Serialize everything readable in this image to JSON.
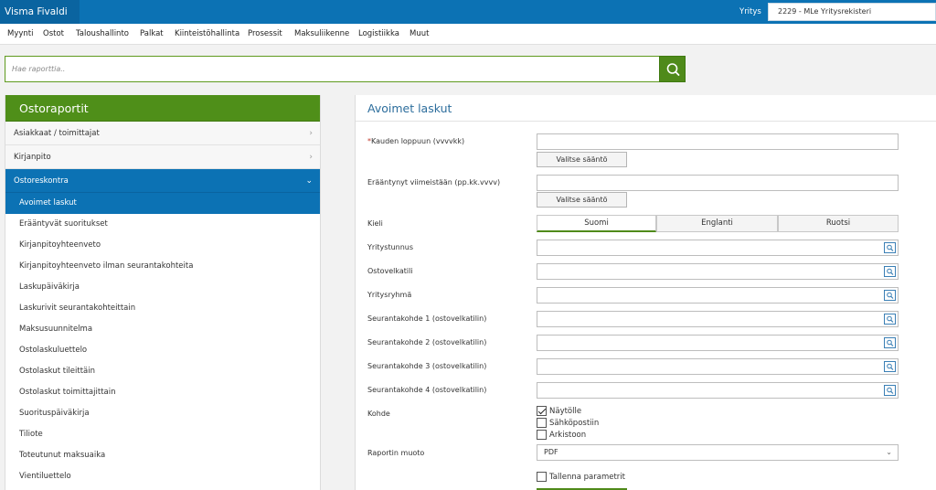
{
  "app": {
    "title": "Visma Fivaldi"
  },
  "company": {
    "label": "Yritys",
    "value": "2229 - MLe Yritysrekisteri"
  },
  "menu": [
    "Myynti",
    "Ostot",
    "Taloushallinto",
    "Palkat",
    "Kiinteistöhallinta",
    "Prosessit",
    "Maksuliikenne",
    "Logistiikka",
    "Muut"
  ],
  "search": {
    "placeholder": "Hae raporttia..",
    "icon": "search-icon"
  },
  "sidebar": {
    "title": "Ostoraportit",
    "categories": [
      {
        "label": "Asiakkaat / toimittajat",
        "icon": "chevron-right-icon"
      },
      {
        "label": "Kirjanpito",
        "icon": "chevron-right-icon"
      },
      {
        "label": "Ostoreskontra",
        "icon": "chevron-down-icon"
      }
    ],
    "subitems": [
      "Avoimet laskut",
      "Erääntyvät suoritukset",
      "Kirjanpitoyhteenveto",
      "Kirjanpitoyhteenveto ilman seurantakohteita",
      "Laskupäiväkirja",
      "Laskurivit seurantakohteittain",
      "Maksusuunnitelma",
      "Ostolaskuluettelo",
      "Ostolaskut tileittäin",
      "Ostolaskut toimittajittain",
      "Suorituspäiväkirja",
      "Tiliote",
      "Toteutunut maksuaika",
      "Vientiluettelo"
    ]
  },
  "form": {
    "title": "Avoimet laskut",
    "kauden_loppuun": {
      "required_mark": "*",
      "label": "Kauden loppuun (vvvvkk)",
      "value": "",
      "rule_button": "Valitse sääntö"
    },
    "eraantynyt": {
      "label": "Erääntynyt viimeistään (pp.kk.vvvv)",
      "value": "",
      "rule_button": "Valitse sääntö"
    },
    "kieli": {
      "label": "Kieli",
      "options": [
        "Suomi",
        "Englanti",
        "Ruotsi"
      ],
      "selected": "Suomi"
    },
    "lookups": [
      {
        "label": "Yritystunnus",
        "value": ""
      },
      {
        "label": "Ostovelkatili",
        "value": ""
      },
      {
        "label": "Yritysryhmä",
        "value": ""
      },
      {
        "label": "Seurantakohde 1 (ostovelkatilin)",
        "value": ""
      },
      {
        "label": "Seurantakohde 2 (ostovelkatilin)",
        "value": ""
      },
      {
        "label": "Seurantakohde 3 (ostovelkatilin)",
        "value": ""
      },
      {
        "label": "Seurantakohde 4 (ostovelkatilin)",
        "value": ""
      }
    ],
    "kohde": {
      "label": "Kohde",
      "options": [
        {
          "label": "Näytölle",
          "checked": true
        },
        {
          "label": "Sähköpostiin",
          "checked": false
        },
        {
          "label": "Arkistoon",
          "checked": false
        }
      ]
    },
    "raportin_muoto": {
      "label": "Raportin muoto",
      "value": "PDF"
    },
    "tallenna": {
      "label": "Tallenna parametrit",
      "checked": false
    }
  },
  "colors": {
    "brand_blue": "#0c72b4",
    "header_green": "#4f8f19",
    "accent_green": "#4f8a1a",
    "title_blue": "#2c6d9c"
  }
}
